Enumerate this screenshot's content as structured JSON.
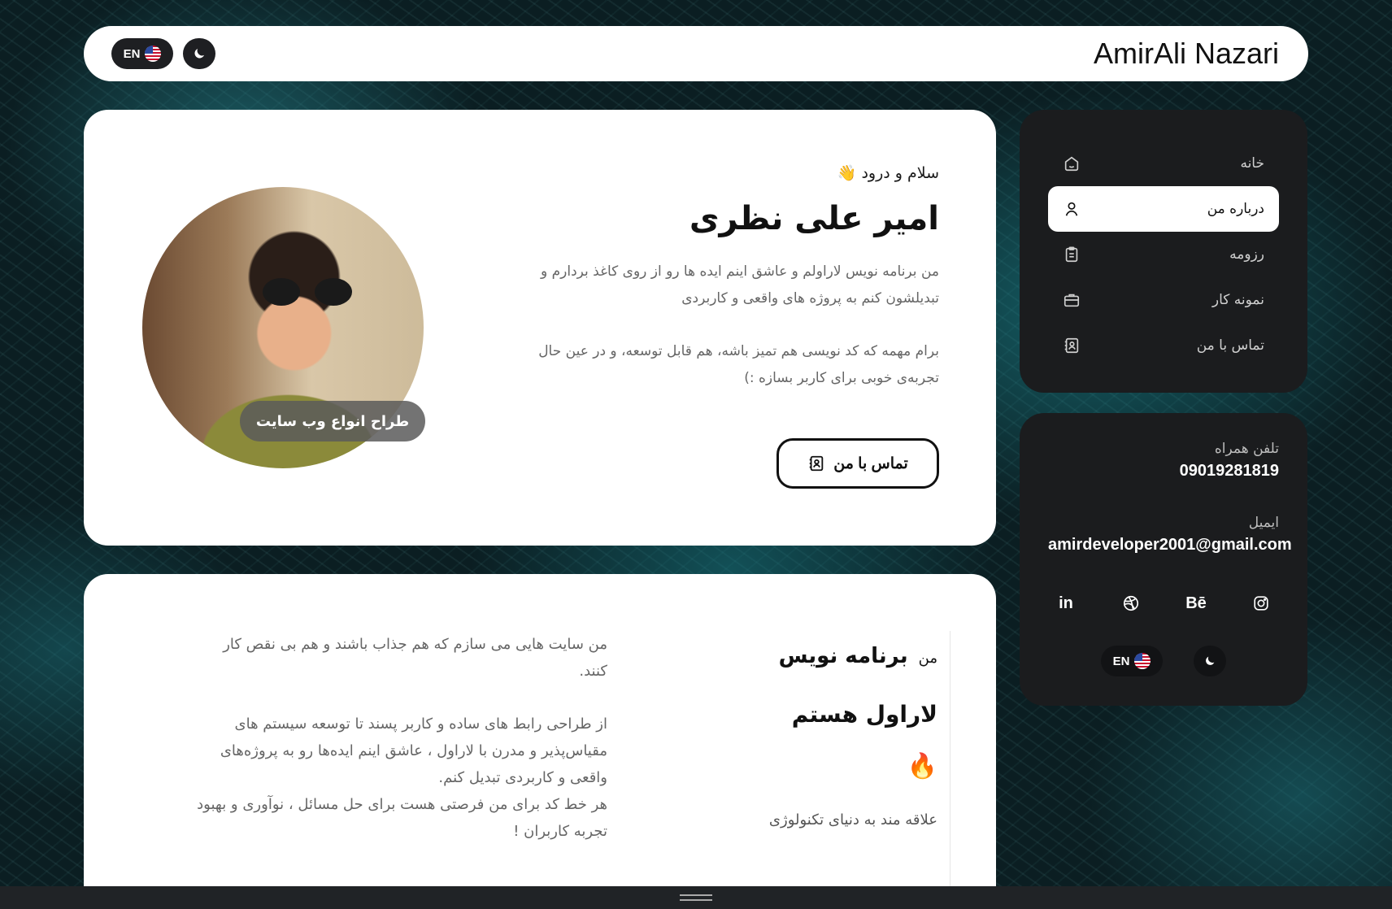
{
  "header": {
    "brand": "AmirAli Nazari",
    "lang_label": "EN"
  },
  "hero": {
    "greeting": "سلام و درود 👋",
    "name": "امیر علی نظری",
    "bio_1": "من برنامه نویس لاراولم و عاشق اینم ایده ها رو از روی کاغذ بردارم و تبدیلشون کنم به پروژه های واقعی و کاربردی",
    "bio_2": "برام مهمه که کد نویسی هم تمیز باشه، هم قابل توسعه، و در عین حال تجربه‌ی خوبی برای کاربر بسازه :)",
    "contact_button": "تماس با من",
    "avatar_tag": "طراح انواع وب سایت"
  },
  "about": {
    "role_prefix": "من",
    "role_title": "برنامه نویس",
    "role_line2": "لاراول هستم",
    "fire_emoji": "🔥",
    "interest": "علاقه مند به دنیای تکنولوژی",
    "para_1": "من سایت هایی می سازم که هم جذاب باشند و هم بی نقص کار کنند.",
    "para_2": "از طراحی رابط های ساده و کاربر پسند تا توسعه سیستم های مقیاس‌پذیر و مدرن با لاراول ، عاشق اینم ایده‌ها رو به پروژه‌های واقعی و کاربردی تبدیل کنم.\nهر خط کد برای من فرصتی هست برای حل مسائل ، نوآوری و بهبود تجربه کاربران !"
  },
  "nav": {
    "items": [
      {
        "label": "خانه",
        "icon": "home-icon"
      },
      {
        "label": "درباره من",
        "icon": "user-icon",
        "active": true
      },
      {
        "label": "رزومه",
        "icon": "clipboard-icon"
      },
      {
        "label": "نمونه کار",
        "icon": "briefcase-icon"
      },
      {
        "label": "تماس با من",
        "icon": "contacts-icon"
      }
    ]
  },
  "contact_card": {
    "phone_label": "تلفن همراه",
    "phone": "09019281819",
    "email_label": "ایمیل",
    "email": "amirdeveloper2001@gmail.com",
    "socials": [
      "linkedin-icon",
      "dribbble-icon",
      "behance-icon",
      "instagram-icon"
    ],
    "linkedin_text": "in",
    "behance_text": "Bē",
    "lang_label": "EN"
  },
  "colors": {
    "dark_panel": "#1b1c1e",
    "card_bg": "#ffffff",
    "accent_teal": "#1e8f96"
  }
}
